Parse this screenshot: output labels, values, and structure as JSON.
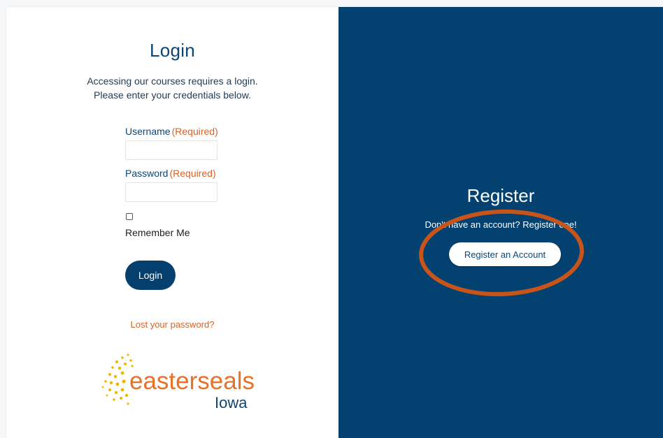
{
  "login": {
    "title": "Login",
    "intro_line1": "Accessing our courses requires a login.",
    "intro_line2": "Please enter your credentials below.",
    "username_label": "Username",
    "password_label": "Password",
    "required_tag": "(Required)",
    "remember_label": "Remember Me",
    "button_label": "Login",
    "lost_password": "Lost your password?"
  },
  "register": {
    "title": "Register",
    "text": "Don't have an account? Register one!",
    "button_label": "Register an Account"
  },
  "logo": {
    "brand": "easterseals",
    "state": "Iowa"
  },
  "colors": {
    "brand_blue": "#034170",
    "accent_orange": "#d6622a",
    "highlight_ring": "#c9541a",
    "sun_yellow": "#f4b400"
  }
}
